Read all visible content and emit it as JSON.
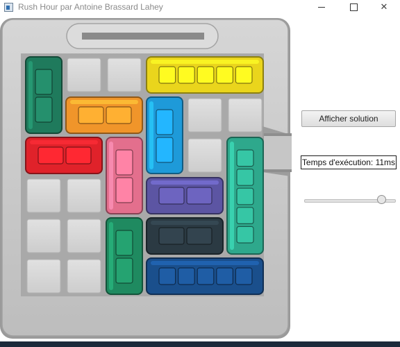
{
  "window": {
    "title": "Rush Hour par Antoine Brassard Lahey",
    "icon": "app-window-icon",
    "controls": [
      "minimize-icon",
      "maximize-icon",
      "close-icon"
    ]
  },
  "board": {
    "size": 6,
    "exit": {
      "side": "right",
      "row": 2
    },
    "vehicles": [
      {
        "id": "green-car-left",
        "color": "#1f7a5c",
        "orientation": "vertical",
        "row": 0,
        "col": 0,
        "length": 2
      },
      {
        "id": "yellow-truck",
        "color": "#ead51c",
        "orientation": "horizontal",
        "row": 0,
        "col": 3,
        "length": 3
      },
      {
        "id": "orange-car",
        "color": "#f0952a",
        "orientation": "horizontal",
        "row": 1,
        "col": 1,
        "length": 2
      },
      {
        "id": "blue-car",
        "color": "#1e9ad9",
        "orientation": "vertical",
        "row": 1,
        "col": 3,
        "length": 2
      },
      {
        "id": "red-car",
        "color": "#e0222a",
        "orientation": "horizontal",
        "row": 2,
        "col": 0,
        "length": 2
      },
      {
        "id": "pink-car",
        "color": "#e36f8d",
        "orientation": "vertical",
        "row": 2,
        "col": 2,
        "length": 2
      },
      {
        "id": "teal-truck",
        "color": "#2ea88c",
        "orientation": "vertical",
        "row": 2,
        "col": 5,
        "length": 3
      },
      {
        "id": "purple-car",
        "color": "#5c55a3",
        "orientation": "horizontal",
        "row": 3,
        "col": 3,
        "length": 2
      },
      {
        "id": "green-car-bottom",
        "color": "#1f8a60",
        "orientation": "vertical",
        "row": 4,
        "col": 2,
        "length": 2
      },
      {
        "id": "dark-car",
        "color": "#2b3a43",
        "orientation": "horizontal",
        "row": 4,
        "col": 3,
        "length": 2
      },
      {
        "id": "navy-truck",
        "color": "#1a4f8c",
        "orientation": "horizontal",
        "row": 5,
        "col": 3,
        "length": 3
      }
    ]
  },
  "panel": {
    "solve_label": "Afficher solution",
    "exec_time": "Temps d'exécution: 11ms",
    "speed_fraction": 0.85
  }
}
